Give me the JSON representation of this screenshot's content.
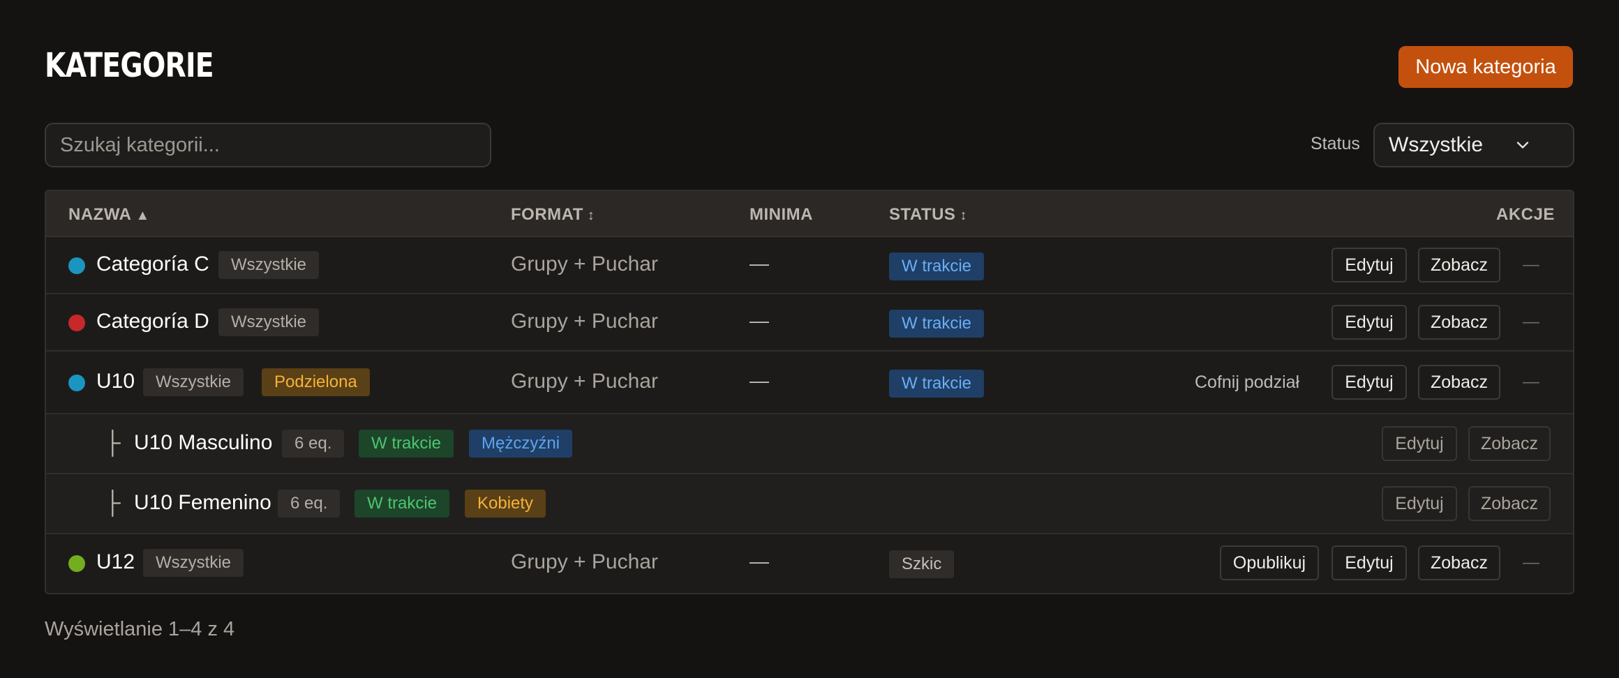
{
  "header": {
    "title": "KATEGORIE",
    "new_button": "Nowa kategoria"
  },
  "toolbar": {
    "search_placeholder": "Szukaj kategorii...",
    "status_label": "Status",
    "status_value": "Wszystkie"
  },
  "table": {
    "columns": {
      "name": "NAZWA",
      "name_sort": "▲",
      "format": "FORMAT",
      "format_sort": "↕",
      "minima": "MINIMA",
      "status": "STATUS",
      "status_sort": "↕",
      "actions": "AKCJE"
    },
    "rows": [
      {
        "dot_color": "#1b95c0",
        "name": "Categoría C",
        "tag": "Wszystkie",
        "format": "Grupy + Puchar",
        "minima": "—",
        "status": "W trakcie",
        "edit": "Edytuj",
        "view": "Zobacz",
        "more": "—"
      },
      {
        "dot_color": "#c8282a",
        "name": "Categoría D",
        "tag": "Wszystkie",
        "format": "Grupy + Puchar",
        "minima": "—",
        "status": "W trakcie",
        "edit": "Edytuj",
        "view": "Zobacz",
        "more": "—"
      },
      {
        "dot_color": "#1b95c0",
        "name": "U10",
        "tag": "Wszystkie",
        "tag2": "Podzielona",
        "format": "Grupy + Puchar",
        "minima": "—",
        "status": "W trakcie",
        "undo_split": "Cofnij podział",
        "edit": "Edytuj",
        "view": "Zobacz",
        "more": "—"
      },
      {
        "tree": "├",
        "name": "U10 Masculino",
        "teams": "6 eq.",
        "status": "W trakcie",
        "gender": "Mężczyźni",
        "edit": "Edytuj",
        "view": "Zobacz"
      },
      {
        "tree": "├",
        "name": "U10 Femenino",
        "teams": "6 eq.",
        "status": "W trakcie",
        "gender": "Kobiety",
        "edit": "Edytuj",
        "view": "Zobacz"
      },
      {
        "dot_color": "#74ad1e",
        "name": "U12",
        "tag": "Wszystkie",
        "format": "Grupy + Puchar",
        "minima": "—",
        "status": "Szkic",
        "publish": "Opublikuj",
        "edit": "Edytuj",
        "view": "Zobacz",
        "more": "—"
      }
    ]
  },
  "footer": {
    "pagination": "Wyświetlanie 1–4 z 4"
  },
  "colors": {
    "accent": "#c4500e",
    "background": "#141312"
  }
}
